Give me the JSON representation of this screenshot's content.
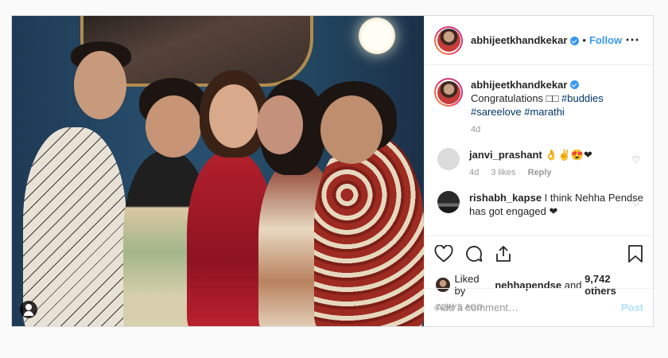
{
  "post": {
    "username": "abhijeetkhandkekar",
    "follow_label": "Follow",
    "caption": {
      "username": "abhijeetkhandkekar",
      "text": "Congratulations □□",
      "hashtags": [
        "#buddies",
        "#sareelove",
        "#marathi"
      ],
      "age": "4d"
    },
    "comments": [
      {
        "username": "janvi_prashant",
        "text": "👌✌😍❤",
        "age": "4d",
        "likes": "3 likes",
        "reply": "Reply"
      },
      {
        "username": "rishabh_kapse",
        "text": "I think Nehha Pendse has got engaged ❤"
      }
    ],
    "liked_by": {
      "prefix": "Liked by",
      "user": "nehhapendse",
      "joiner": "and",
      "others": "9,742 others"
    },
    "date": "4 DAYS AGO",
    "add_comment_placeholder": "Add a comment…",
    "post_label": "Post"
  },
  "colors": {
    "accent": "#3897f0",
    "post_disabled": "#b2dffc",
    "hashtag": "#003569"
  },
  "icons": {
    "more": "more-options-icon",
    "heart": "heart-icon",
    "comment": "comment-icon",
    "share": "share-icon",
    "save": "bookmark-icon",
    "tag": "tagged-user-icon"
  }
}
